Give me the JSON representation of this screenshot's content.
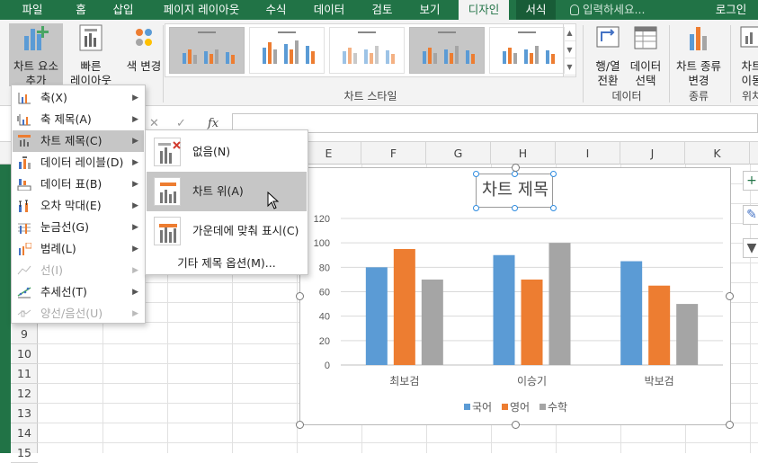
{
  "tabs": [
    "파일",
    "홈",
    "삽입",
    "페이지 레이아웃",
    "수식",
    "데이터",
    "검토",
    "보기",
    "디자인",
    "서식"
  ],
  "active_tab": "디자인",
  "tell_me": "입력하세요...",
  "login": "로그인",
  "ribbon": {
    "add_element": "차트 요소\n추가",
    "quick_layout": "빠른\n레이아웃",
    "change_colors": "색 변경",
    "chart_styles_label": "차트 스타일",
    "switch_row_col": "행/열\n전환",
    "select_data": "데이터\n선택",
    "data_group": "데이터",
    "change_type": "차트 종류\n변경",
    "type_group": "종류",
    "move_chart": "차트\n이동",
    "location_group": "위치"
  },
  "accent_colors": {
    "excel_green": "#217346",
    "blue": "#5b9bd5",
    "orange": "#ed7d31",
    "gray": "#a5a5a5"
  },
  "columns": [
    "E",
    "F",
    "G",
    "H",
    "I",
    "J",
    "K"
  ],
  "rows": [
    "9",
    "10",
    "11",
    "12",
    "13",
    "14",
    "15"
  ],
  "element_menu": {
    "items": [
      {
        "label": "축(X)",
        "icon": "axes-icon",
        "disabled": false
      },
      {
        "label": "축 제목(A)",
        "icon": "axis-title-icon",
        "disabled": false
      },
      {
        "label": "차트 제목(C)",
        "icon": "chart-title-icon",
        "disabled": false
      },
      {
        "label": "데이터 레이블(D)",
        "icon": "data-labels-icon",
        "disabled": false
      },
      {
        "label": "데이터 표(B)",
        "icon": "data-table-icon",
        "disabled": false
      },
      {
        "label": "오차 막대(E)",
        "icon": "error-bars-icon",
        "disabled": false
      },
      {
        "label": "눈금선(G)",
        "icon": "gridlines-icon",
        "disabled": false
      },
      {
        "label": "범례(L)",
        "icon": "legend-icon",
        "disabled": false
      },
      {
        "label": "선(I)",
        "icon": "lines-icon",
        "disabled": true
      },
      {
        "label": "추세선(T)",
        "icon": "trendline-icon",
        "disabled": false
      },
      {
        "label": "양선/음선(U)",
        "icon": "up-down-bars-icon",
        "disabled": true
      }
    ]
  },
  "submenu": {
    "none": "없음(N)",
    "above_chart": "차트 위(A)",
    "centered_overlay": "가운데에 맞춰 표시(C)",
    "more_options": "기타 제목 옵션(M)..."
  },
  "chart_data": {
    "type": "bar",
    "title": "차트 제목",
    "categories": [
      "최보검",
      "이승기",
      "박보검"
    ],
    "series": [
      {
        "name": "국어",
        "color": "#5b9bd5",
        "values": [
          80,
          90,
          85
        ]
      },
      {
        "name": "영어",
        "color": "#ed7d31",
        "values": [
          95,
          70,
          65
        ]
      },
      {
        "name": "수학",
        "color": "#a5a5a5",
        "values": [
          70,
          100,
          50
        ]
      }
    ],
    "yticks": [
      0,
      20,
      40,
      60,
      80,
      100,
      120
    ],
    "ylim": [
      0,
      120
    ],
    "grid": true,
    "legend": "bottom"
  }
}
